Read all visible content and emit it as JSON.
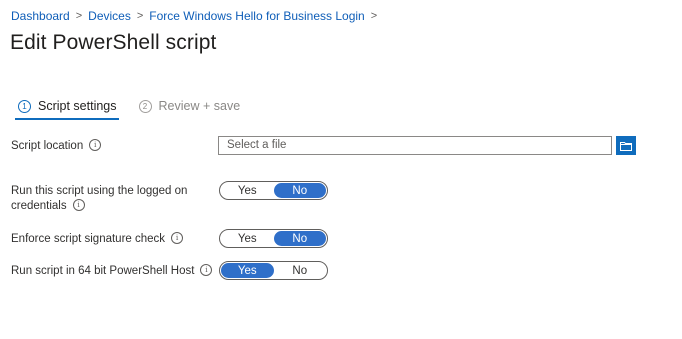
{
  "breadcrumb": {
    "items": [
      "Dashboard",
      "Devices",
      "Force Windows Hello for Business Login"
    ],
    "separator": ">"
  },
  "page": {
    "title": "Edit PowerShell script"
  },
  "wizard": {
    "steps": [
      {
        "number": "1",
        "label": "Script settings",
        "active": true
      },
      {
        "number": "2",
        "label": "Review + save",
        "active": false
      }
    ]
  },
  "form": {
    "script_location": {
      "label": "Script location",
      "placeholder": "Select a file"
    },
    "run_as_logged_on": {
      "label_line1": "Run this script using the logged on",
      "label_line2": "credentials",
      "options": [
        "Yes",
        "No"
      ],
      "selected": "No"
    },
    "enforce_signature": {
      "label": "Enforce script signature check",
      "options": [
        "Yes",
        "No"
      ],
      "selected": "No"
    },
    "run_64bit": {
      "label": "Run script in 64 bit PowerShell Host",
      "options": [
        "Yes",
        "No"
      ],
      "selected": "Yes"
    }
  },
  "icons": {
    "info": "info-icon",
    "folder": "folder-icon"
  },
  "colors": {
    "accent": "#0f6cbd",
    "toggle_selected": "#2f6fc9",
    "link": "#0f5eb8"
  }
}
